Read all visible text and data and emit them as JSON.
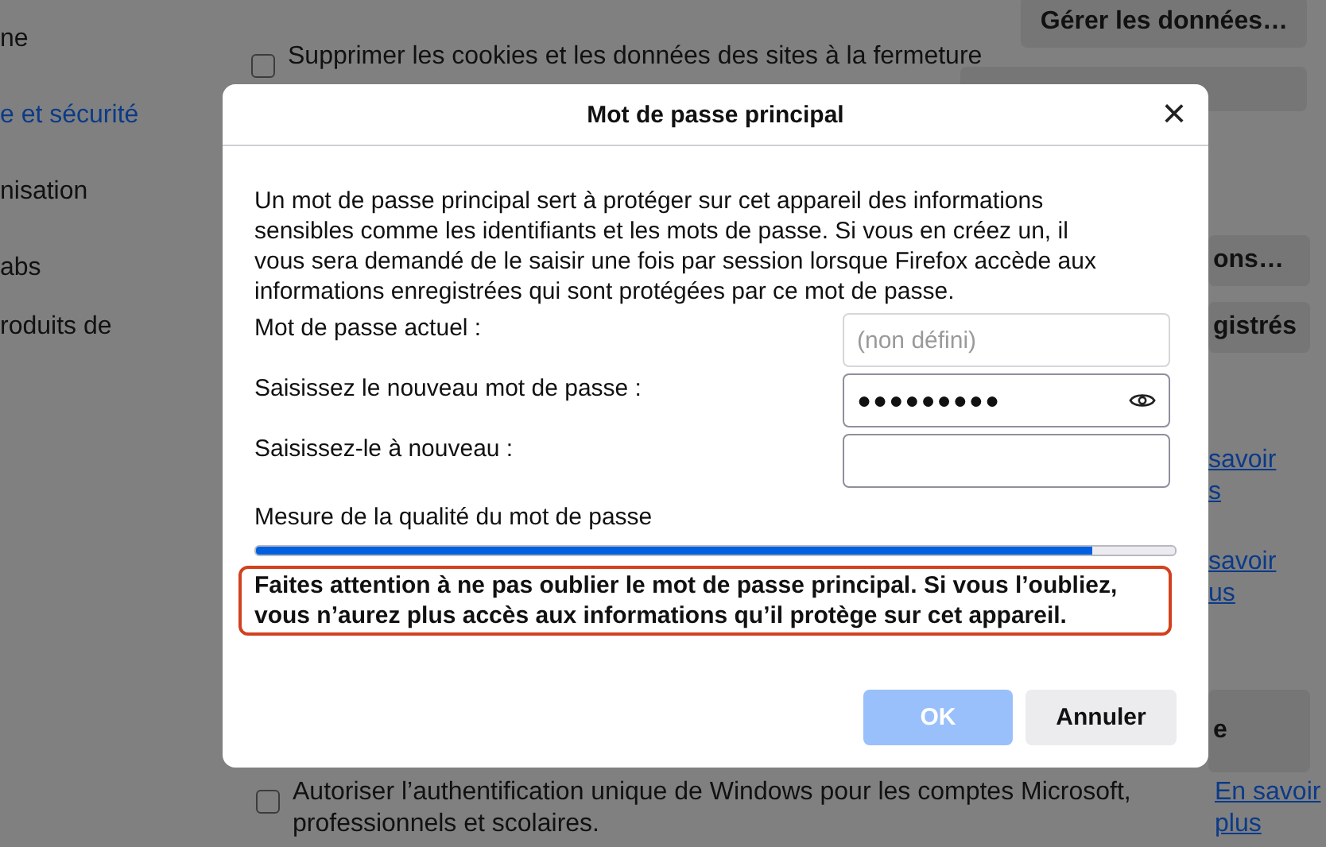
{
  "background": {
    "nav_items": [
      {
        "label": "ne",
        "selected": false
      },
      {
        "label": "e et sécurité",
        "selected": true
      },
      {
        "label": "nisation",
        "selected": false
      },
      {
        "label": "abs",
        "selected": false
      },
      {
        "label": "roduits de",
        "selected": false
      }
    ],
    "cookie_option": {
      "label": "Supprimer les cookies et les données des sites à la fermeture",
      "checked": false
    },
    "data_button": "Gérer les données…",
    "right_items": [
      {
        "kind": "button",
        "lines": [
          "ons…"
        ]
      },
      {
        "kind": "button",
        "lines": [
          "gistrés"
        ]
      },
      {
        "kind": "link",
        "lines": [
          "savoir",
          "s"
        ]
      },
      {
        "kind": "link",
        "lines": [
          "savoir",
          "us"
        ]
      },
      {
        "kind": "button",
        "lines": [
          "e"
        ]
      }
    ],
    "windows_option": {
      "label": "Autoriser l’authentification unique de Windows pour les comptes Microsoft, professionnels et scolaires.",
      "checked": false,
      "link": "En savoir plus"
    }
  },
  "dialog": {
    "title": "Mot de passe principal",
    "close": "×",
    "intro": "Un mot de passe principal sert à protéger sur cet appareil des informations sensibles comme les identifiants et les mots de passe. Si vous en créez un, il vous sera demandé de le saisir une fois par session lorsque Firefox accède aux informations enregistrées qui sont protégées par ce mot de passe.",
    "fields": [
      {
        "label": "Mot de passe actuel :",
        "placeholder": "(non défini)",
        "disabled": true,
        "kind": "text"
      },
      {
        "label": "Saisissez le nouveau mot de passe :",
        "value": "●●●●●●●●●",
        "disabled": false,
        "kind": "password"
      },
      {
        "label": "Saisissez-le à nouveau :",
        "disabled": false,
        "kind": "text"
      }
    ],
    "meter": {
      "label": "Mesure de la qualité du mot de passe",
      "level": 0.91
    },
    "warning": "Faites attention à ne pas oublier le mot de passe principal. Si vous l’oubliez, vous n’aurez plus accès aux informations qu’il protège sur cet appareil.",
    "buttons": [
      {
        "label": "OK",
        "kind": "primary",
        "disabled": true
      },
      {
        "label": "Annuler",
        "kind": "secondary",
        "disabled": false
      }
    ]
  }
}
